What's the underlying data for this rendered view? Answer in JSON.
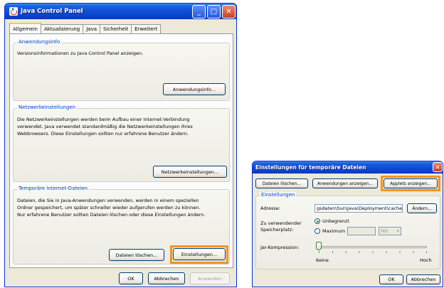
{
  "control_panel": {
    "title": "Java Control Panel",
    "tabs": [
      "Allgemein",
      "Aktualisierung",
      "Java",
      "Sicherheit",
      "Erweitert"
    ],
    "groups": {
      "about": {
        "label": "Anwendungsinfo",
        "text": "Versionsinformationen zu Java Control Panel anzeigen.",
        "button": "Anwendungsinfo..."
      },
      "network": {
        "label": "Netzwerkeinstellungen",
        "text_lines": [
          "Die Netzwerkeinstellungen werden beim Aufbau einer Internet-Verbindung",
          "verwendet. Java verwendet standardmäßig die Netzwerkeinstellungen Ihres",
          "Webbrowsers. Diese Einstellungen sollten nur erfahrene Benutzer ändern."
        ],
        "button": "Netzwerkeinstellungen..."
      },
      "temp": {
        "label": "Temporäre Internet-Dateien",
        "text_lines": [
          "Dateien, die Sie in Java-Anwendungen verwenden, werden in einem speziellen",
          "Ordner gespeichert, um später schneller wieder aufgerufen werden zu können.",
          "Nur erfahrene Benutzer sollten Dateien löschen oder diese Einstellungen ändern."
        ],
        "delete_button": "Dateien löschen...",
        "settings_button": "Einstellungen..."
      }
    },
    "footer": {
      "ok": "OK",
      "cancel": "Abbrechen",
      "apply": "Anwenden"
    }
  },
  "temp_dialog": {
    "title": "Einstellungen für temporäre Dateien",
    "top_buttons": [
      "Dateien löschen...",
      "Anwendungen anzeigen...",
      "Applets anzeigen..."
    ],
    "group_label": "Einstellungen",
    "location_label": "Adresse:",
    "location_value": "gsdaten\\Sun\\Java\\Deployment\\cache",
    "change_button": "Ändern...",
    "space_label_lines": [
      "Zu verwendender",
      "Speicherplatz:"
    ],
    "radio_unlimited": "Unbegrenzt",
    "radio_maximum": "Maximum",
    "max_unit": "MB",
    "compression_label": "Jar-Kompression:",
    "slider_min": "Keine",
    "slider_max": "Hoch",
    "slider_level": 0,
    "ok": "OK",
    "cancel": "Abbrechen"
  },
  "colors": {
    "highlight": "#f7931e",
    "titlebar": "#0d4bd6",
    "group_label": "#0046d5"
  }
}
